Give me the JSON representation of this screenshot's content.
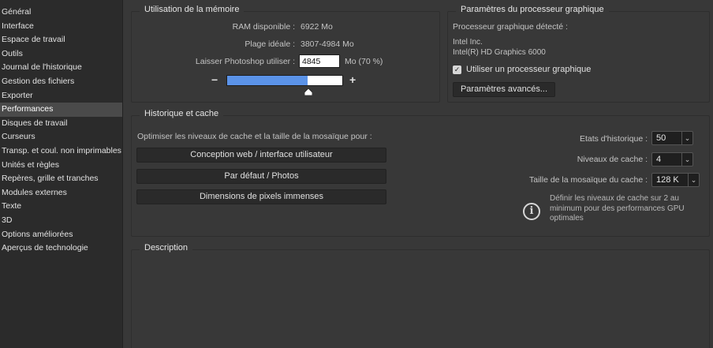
{
  "sidebar": {
    "items": [
      {
        "label": "Général"
      },
      {
        "label": "Interface"
      },
      {
        "label": "Espace de travail"
      },
      {
        "label": "Outils"
      },
      {
        "label": "Journal de l'historique"
      },
      {
        "label": "Gestion des fichiers"
      },
      {
        "label": "Exporter"
      },
      {
        "label": "Performances",
        "selected": true
      },
      {
        "label": "Disques de travail"
      },
      {
        "label": "Curseurs"
      },
      {
        "label": "Transp. et coul. non imprimables"
      },
      {
        "label": "Unités et règles"
      },
      {
        "label": "Repères, grille et tranches"
      },
      {
        "label": "Modules externes"
      },
      {
        "label": "Texte"
      },
      {
        "label": "3D"
      },
      {
        "label": "Options améliorées"
      },
      {
        "label": "Aperçus de technologie"
      }
    ]
  },
  "memory": {
    "title": "Utilisation de la mémoire",
    "ram_label": "RAM disponible :",
    "ram_value": "6922 Mo",
    "range_label": "Plage idéale :",
    "range_value": "3807-4984 Mo",
    "let_label": "Laisser Photoshop utiliser :",
    "let_value": "4845",
    "let_unit": "Mo (70 %)",
    "slider_fraction": 0.7,
    "minus": "−",
    "plus": "+"
  },
  "gpu": {
    "title": "Paramètres du processeur graphique",
    "detected_label": "Processeur graphique détecté :",
    "vendor": "Intel Inc.",
    "model": "Intel(R) HD Graphics 6000",
    "use_gpu_label": "Utiliser un processeur graphique",
    "use_gpu_checked": true,
    "advanced_button": "Paramètres avancés..."
  },
  "cache": {
    "title": "Historique et cache",
    "optimize_label": "Optimiser les niveaux de cache et la taille de la mosaïque pour :",
    "buttons": {
      "web": "Conception web / interface utilisateur",
      "default": "Par défaut / Photos",
      "huge": "Dimensions de pixels immenses"
    },
    "history_label": "Etats d'historique :",
    "history_value": "50",
    "levels_label": "Niveaux de cache :",
    "levels_value": "4",
    "tile_label": "Taille de la mosaïque du cache :",
    "tile_value": "128 K",
    "info_text": "Définir les niveaux de cache sur 2 au minimum pour des performances GPU optimales",
    "info_icon": "info-icon"
  },
  "description": {
    "title": "Description"
  },
  "colors": {
    "slider_fill": "#5b93e8",
    "selected_sidebar": "#4a4a4a",
    "background": "#383838",
    "sidebar_background": "#2b2b2b"
  }
}
